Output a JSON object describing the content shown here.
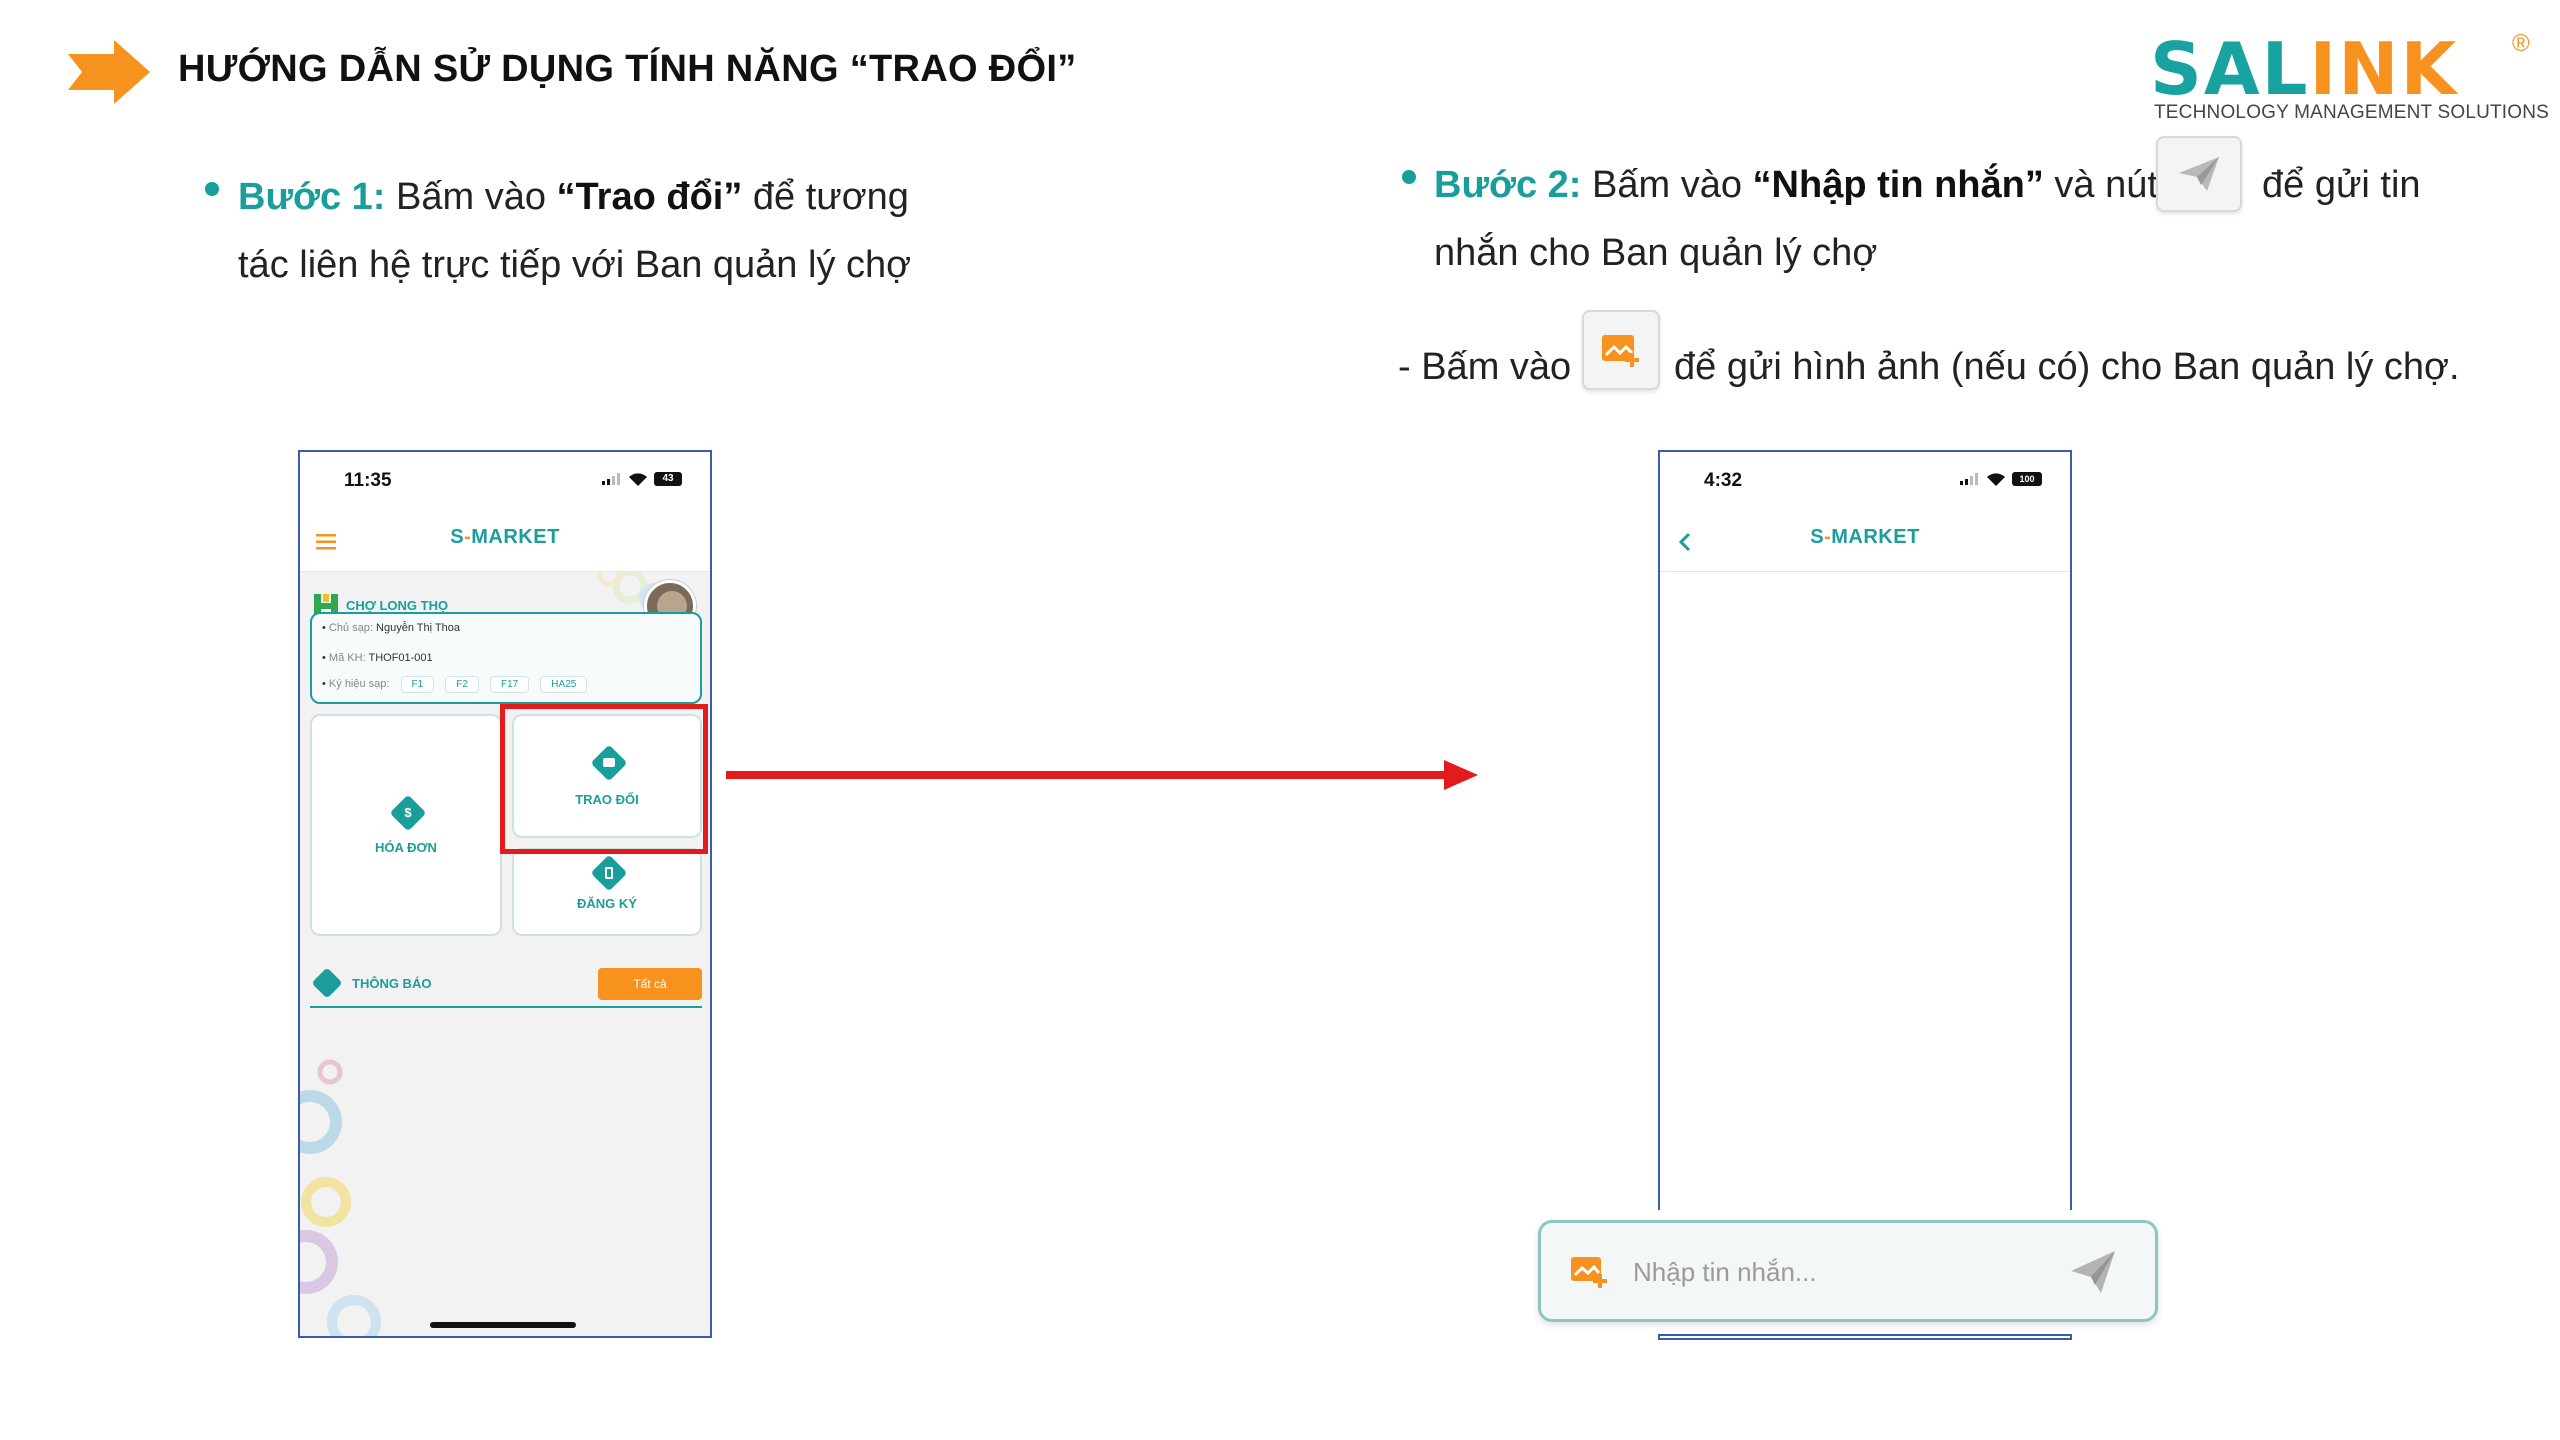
{
  "header": {
    "title": "HƯỚNG DẪN SỬ DỤNG TÍNH NĂNG “TRAO ĐỔI”"
  },
  "logo": {
    "word_part1": "SAL",
    "word_part2": "INK",
    "registered": "®",
    "tagline": "TECHNOLOGY MANAGEMENT SOLUTIONS"
  },
  "step1": {
    "label": "Bước 1:",
    "text_a": " Bấm vào ",
    "bold": "“Trao đổi”",
    "text_b": " để tương",
    "line2": "tác liên hệ trực tiếp với Ban quản lý chợ"
  },
  "step2": {
    "label": "Bước 2:",
    "text_a": " Bấm vào ",
    "bold": "“Nhập tin nhắn”",
    "text_b": " và nút",
    "text_c": "để gửi tin",
    "line2": "nhắn cho Ban quản lý chợ"
  },
  "note": {
    "prefix": "- Bấm vào",
    "suffix": "để gửi hình ảnh (nếu có) cho Ban quản lý chợ."
  },
  "phone_left": {
    "time": "11:35",
    "battery": "43",
    "brand_a": "S",
    "brand_b": "-",
    "brand_c": "MARKET",
    "market_name": "CHỢ LONG THỌ",
    "owner_label": "Chủ sạp:",
    "owner_value": "Nguyễn Thị Thoa",
    "code_label": "Mã KH:",
    "code_value": "THOF01-001",
    "stall_label": "Ký hiệu sạp:",
    "stalls": [
      "F1",
      "F2",
      "F17",
      "HA25"
    ],
    "tile_invoice": "HÓA ĐƠN",
    "tile_exchange": "TRAO ĐỔI",
    "tile_register": "ĐĂNG KÝ",
    "notif_label": "THÔNG BÁO",
    "see_all": "Tất cả"
  },
  "phone_right": {
    "time": "4:32",
    "battery": "100",
    "brand_a": "S",
    "brand_b": "-",
    "brand_c": "MARKET"
  },
  "composer": {
    "placeholder": "Nhập tin nhắn..."
  },
  "colors": {
    "teal": "#1a9e9b",
    "orange": "#f7921e",
    "red": "#e31b1b"
  },
  "icons": [
    "arrow-right-icon",
    "send-icon",
    "add-image-icon",
    "menu-icon",
    "back-icon",
    "signal-icon",
    "wifi-icon",
    "battery-icon",
    "store-icon",
    "dollar-icon",
    "chat-icon",
    "edit-icon",
    "bell-icon"
  ]
}
